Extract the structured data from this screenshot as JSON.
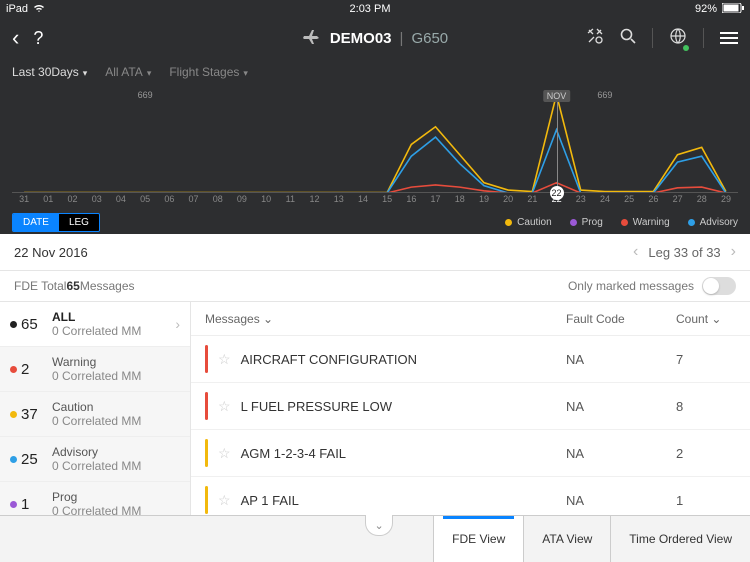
{
  "status": {
    "device": "iPad",
    "time": "2:03 PM",
    "battery": "92%"
  },
  "header": {
    "demo": "DEMO03",
    "model": "G650"
  },
  "filters": {
    "range": "Last 30Days",
    "ata": "All ATA",
    "stages": "Flight Stages"
  },
  "toggle": {
    "a": "DATE",
    "b": "LEG"
  },
  "legend": {
    "caution": "Caution",
    "prog": "Prog",
    "warning": "Warning",
    "advisory": "Advisory"
  },
  "colors": {
    "caution": "#f2b90d",
    "prog": "#9b59d6",
    "warning": "#e74c3c",
    "advisory": "#2e9fe6",
    "all": "#222"
  },
  "chart_data": {
    "type": "line",
    "xlabel": "",
    "ylabel": "",
    "ylim": [
      0,
      700
    ],
    "categories": [
      "31",
      "01",
      "02",
      "03",
      "04",
      "05",
      "06",
      "07",
      "08",
      "09",
      "10",
      "11",
      "12",
      "13",
      "14",
      "15",
      "16",
      "17",
      "18",
      "19",
      "20",
      "21",
      "22",
      "23",
      "24",
      "25",
      "26",
      "27",
      "28",
      "29"
    ],
    "series": [
      {
        "name": "Caution",
        "color": "#f2b90d",
        "values": [
          3,
          3,
          3,
          3,
          3,
          3,
          3,
          3,
          3,
          3,
          3,
          3,
          3,
          3,
          3,
          3,
          330,
          450,
          260,
          70,
          20,
          10,
          669,
          20,
          10,
          10,
          10,
          260,
          310,
          10
        ]
      },
      {
        "name": "Advisory",
        "color": "#2e9fe6",
        "values": [
          0,
          0,
          0,
          0,
          0,
          0,
          0,
          0,
          0,
          0,
          0,
          0,
          0,
          0,
          0,
          0,
          250,
          380,
          200,
          50,
          0,
          0,
          430,
          0,
          0,
          0,
          0,
          210,
          250,
          0
        ]
      },
      {
        "name": "Warning",
        "color": "#e74c3c",
        "values": [
          0,
          0,
          0,
          0,
          0,
          0,
          0,
          0,
          0,
          0,
          0,
          0,
          0,
          0,
          0,
          0,
          40,
          55,
          40,
          15,
          0,
          0,
          70,
          0,
          0,
          0,
          0,
          35,
          40,
          0
        ]
      },
      {
        "name": "Prog",
        "color": "#9b59d6",
        "values": [
          0,
          0,
          0,
          0,
          0,
          0,
          0,
          0,
          0,
          0,
          0,
          0,
          0,
          0,
          0,
          0,
          0,
          0,
          0,
          0,
          0,
          0,
          0,
          0,
          0,
          0,
          0,
          0,
          0,
          0
        ]
      }
    ],
    "peaks": [
      {
        "x": "05",
        "label": "669"
      },
      {
        "x": "22",
        "label": "NOV",
        "box": true
      },
      {
        "x": "24",
        "label": "669"
      }
    ],
    "selected": "22"
  },
  "date_label": "22 Nov 2016",
  "leg_label": "Leg 33 of 33",
  "fde_total": {
    "prefix": "FDE Total ",
    "count": "65",
    "suffix": " Messages"
  },
  "marked_label": "Only marked messages",
  "side": [
    {
      "count": "65",
      "label": "ALL",
      "sub": "0 Correlated MM",
      "color": "#222",
      "sel": true
    },
    {
      "count": "2",
      "label": "Warning",
      "sub": "0 Correlated MM",
      "color": "#e74c3c"
    },
    {
      "count": "37",
      "label": "Caution",
      "sub": "0 Correlated MM",
      "color": "#f2b90d"
    },
    {
      "count": "25",
      "label": "Advisory",
      "sub": "0 Correlated MM",
      "color": "#2e9fe6"
    },
    {
      "count": "1",
      "label": "Prog",
      "sub": "0 Correlated MM",
      "color": "#9b59d6"
    }
  ],
  "table": {
    "headers": {
      "messages": "Messages",
      "fault": "Fault Code",
      "count": "Count"
    },
    "rows": [
      {
        "color": "#e74c3c",
        "msg": "AIRCRAFT CONFIGURATION",
        "fc": "NA",
        "ct": "7"
      },
      {
        "color": "#e74c3c",
        "msg": "L FUEL PRESSURE LOW",
        "fc": "NA",
        "ct": "8"
      },
      {
        "color": "#f2b90d",
        "msg": "AGM 1-2-3-4 FAIL",
        "fc": "NA",
        "ct": "2"
      },
      {
        "color": "#f2b90d",
        "msg": "AP 1 FAIL",
        "fc": "NA",
        "ct": "1"
      }
    ]
  },
  "tabs": {
    "fde": "FDE View",
    "ata": "ATA View",
    "time": "Time Ordered View"
  }
}
